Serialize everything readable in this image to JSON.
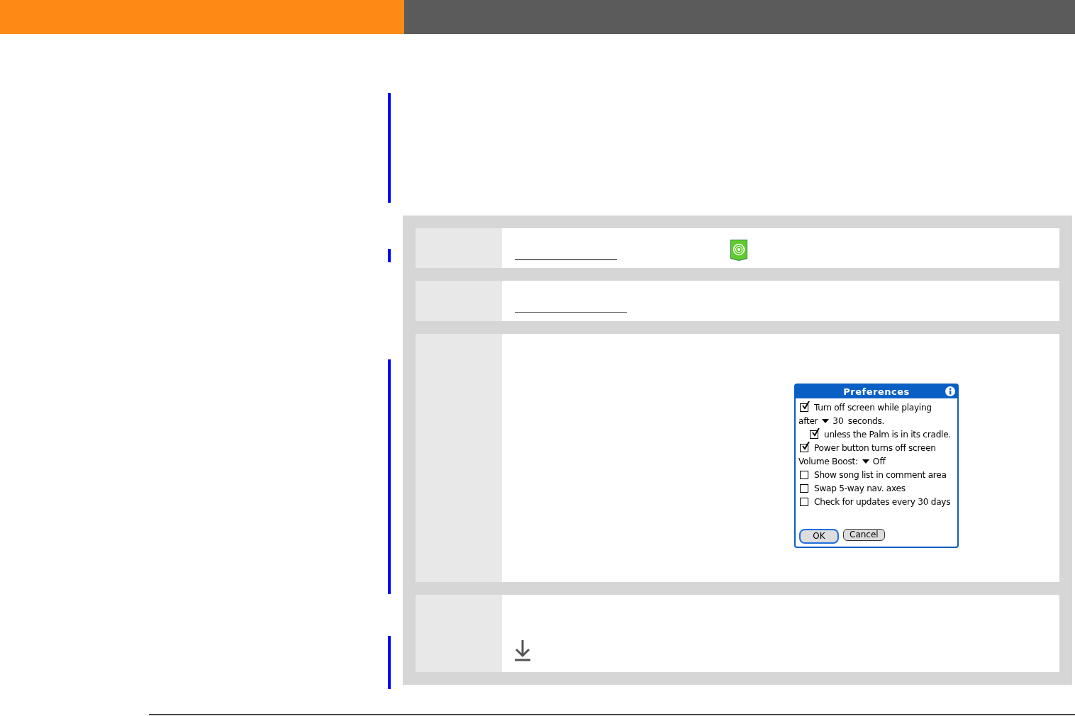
{
  "steps": [
    {
      "kind": "link-app"
    },
    {
      "kind": "link"
    },
    {
      "kind": "dialog"
    },
    {
      "kind": "download"
    }
  ],
  "dialog": {
    "title": "Preferences",
    "rows": [
      {
        "kind": "checkbox",
        "label": "Turn off screen while playing",
        "checked": true
      },
      {
        "kind": "dropdown",
        "label": "after",
        "value": "30",
        "suffix": "seconds.",
        "children": [
          {
            "kind": "checkbox",
            "label": "unless the Palm is in its cradle.",
            "checked": true
          }
        ]
      },
      {
        "kind": "checkbox",
        "label": "Power button turns off screen",
        "checked": true
      },
      {
        "kind": "dropdown",
        "label": "Volume Boost:",
        "value": "Off"
      },
      {
        "kind": "checkbox",
        "label": "Show song list in comment area",
        "checked": false
      },
      {
        "kind": "checkbox",
        "label": "Swap 5-way nav. axes",
        "checked": false
      },
      {
        "kind": "checkbox",
        "label": "Check for updates every 30 days",
        "checked": false
      }
    ],
    "buttons": [
      {
        "label": "OK",
        "selected": true
      },
      {
        "label": "Cancel",
        "selected": false
      }
    ]
  }
}
